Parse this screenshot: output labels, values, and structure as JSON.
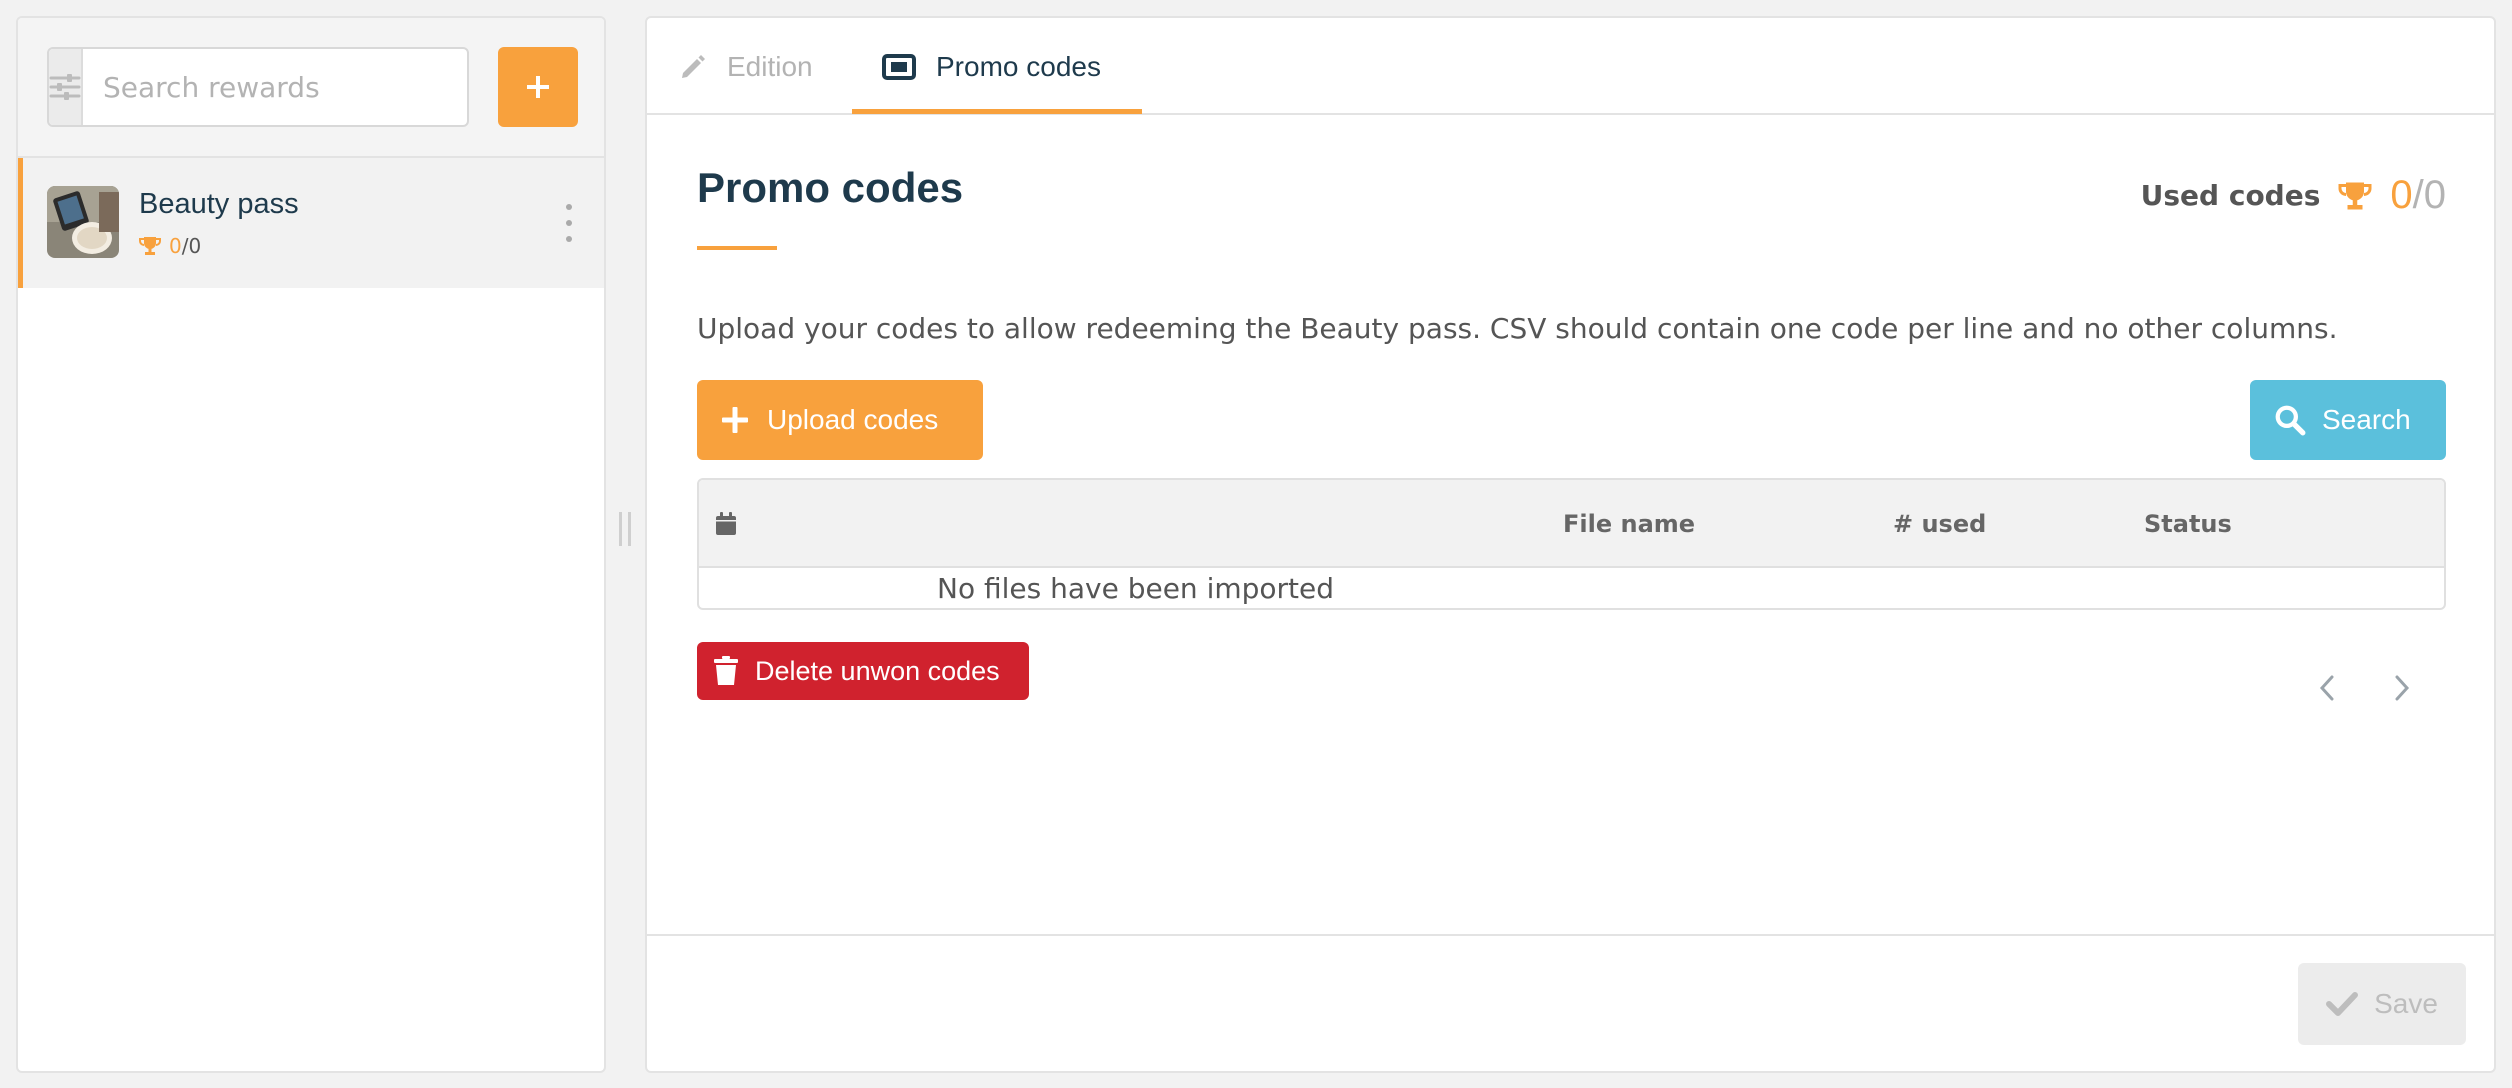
{
  "sidebar": {
    "search": {
      "placeholder": "Search rewards"
    },
    "add_label": "+",
    "items": [
      {
        "name": "Beauty pass",
        "used": "0",
        "separator": "/",
        "total": "0"
      }
    ]
  },
  "tabs": [
    {
      "label": "Edition",
      "icon": "pencil-icon",
      "active": false
    },
    {
      "label": "Promo codes",
      "icon": "ticket-icon",
      "active": true
    }
  ],
  "main": {
    "title": "Promo codes",
    "used_codes": {
      "label": "Used codes",
      "used": "0",
      "separator": "/",
      "total": "0"
    },
    "description": "Upload your codes to allow redeeming the Beauty pass. CSV should contain one code per line and no other columns.",
    "upload_label": "Upload codes",
    "search_label": "Search",
    "table": {
      "columns": [
        "",
        "File name",
        "# used",
        "Status"
      ],
      "empty_message": "No files have been imported"
    },
    "delete_label": "Delete unwon codes",
    "save_label": "Save"
  },
  "colors": {
    "accent": "#f8a13d",
    "info": "#5bc0dc",
    "danger": "#d0222e",
    "heading": "#1e3a4c",
    "disabled": "#ececec"
  }
}
